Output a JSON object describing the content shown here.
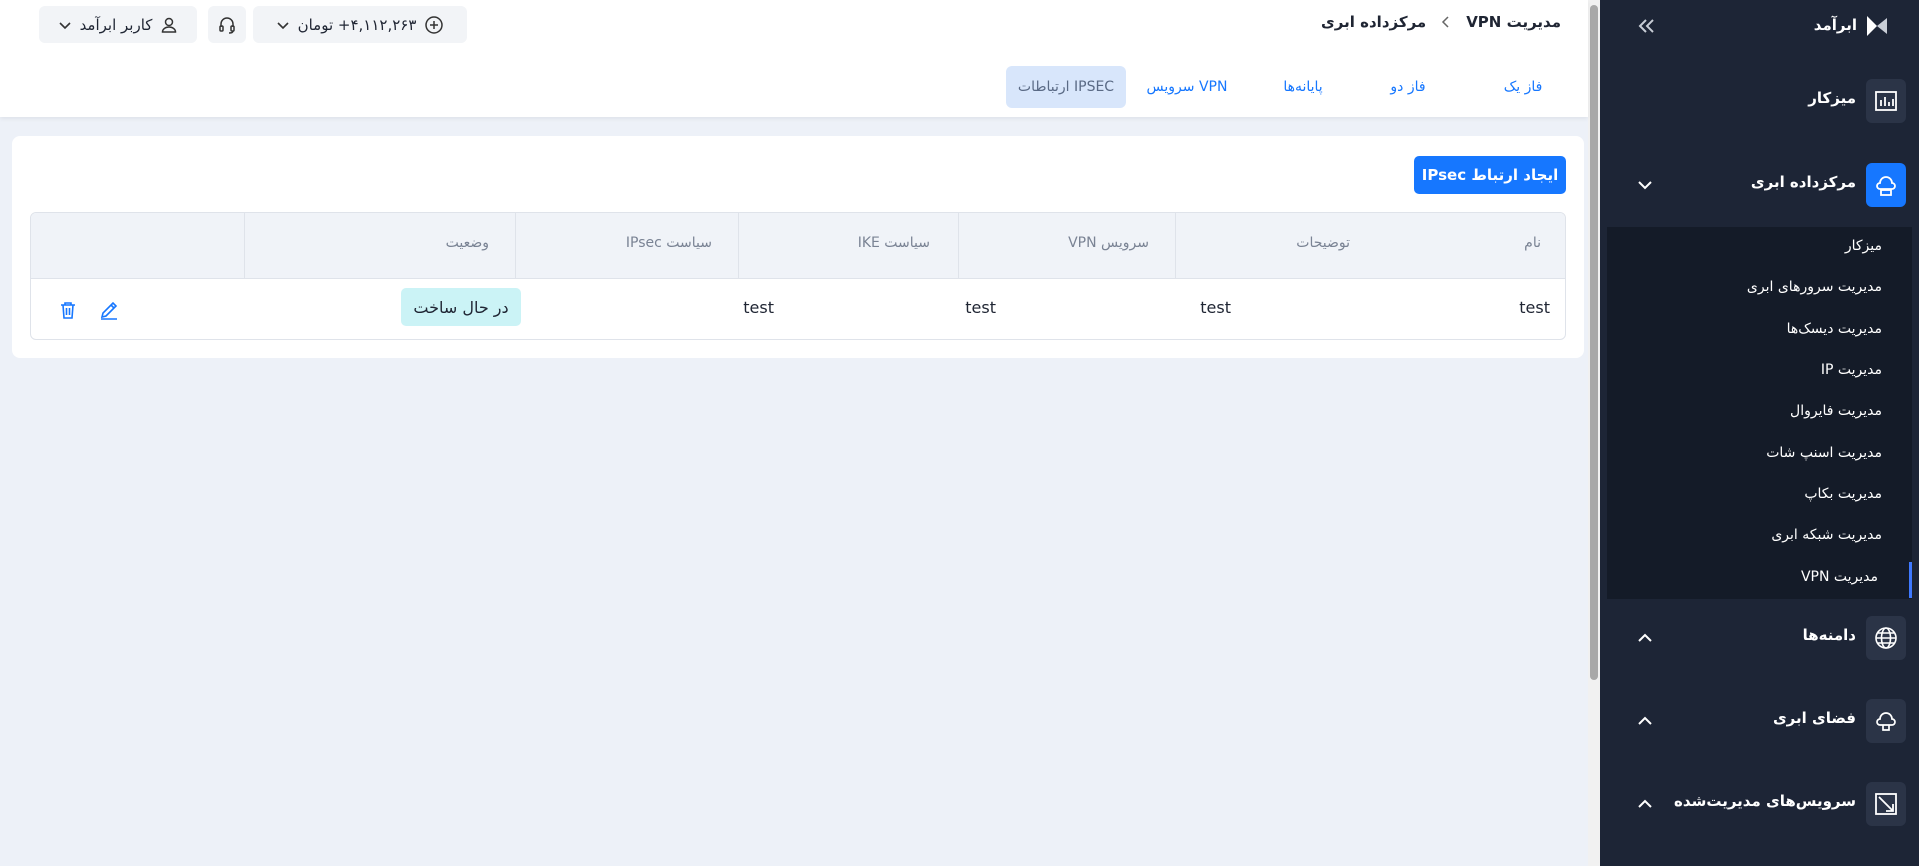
{
  "brand": {
    "name": "ابرآمد"
  },
  "sidebar": {
    "main_items": [
      {
        "label": "میزکار",
        "icon": "dashboard-chart-icon"
      },
      {
        "label": "مرکزداده ابری",
        "icon": "cloud-datacenter-icon"
      },
      {
        "label": "دامنه‌ها",
        "icon": "globe-icon"
      },
      {
        "label": "فضای ابری",
        "icon": "cloud-storage-icon"
      },
      {
        "label": "سرویس‌های مدیریت‌شده",
        "icon": "managed-services-icon"
      }
    ],
    "sub_items": [
      {
        "label": "میزکار"
      },
      {
        "label": "مدیریت سرورهای ابری"
      },
      {
        "label": "مدیریت دیسک‌ها"
      },
      {
        "label": "مدیریت IP"
      },
      {
        "label": "مدیریت فایروال"
      },
      {
        "label": "مدیریت اسنپ شات"
      },
      {
        "label": "مدیریت بکاپ"
      },
      {
        "label": "مدیریت شبکه ابری"
      },
      {
        "label": "مدیریت VPN",
        "active": true
      }
    ]
  },
  "breadcrumb": {
    "parent": "مرکزداده ابری",
    "current": "مدیریت VPN"
  },
  "header": {
    "balance": "۴,۱۱۲,۲۶۳+ تومان",
    "user": "کاربر ابرآمد"
  },
  "tabs": [
    {
      "label": "فاز یک"
    },
    {
      "label": "فاز دو"
    },
    {
      "label": "پایانه‌ها"
    },
    {
      "label": "سرویس VPN"
    },
    {
      "label": "ارتباطات IPSEC",
      "active": true
    }
  ],
  "page": {
    "create_button": "ایجاد ارتباط IPsec"
  },
  "table": {
    "columns": [
      "نام",
      "توضیحات",
      "سرویس VPN",
      "سیاست IKE",
      "سیاست IPsec",
      "وضعیت",
      ""
    ],
    "rows": [
      {
        "name": "test",
        "description": "",
        "vpn_service": "test",
        "ike_policy": "test",
        "ipsec_policy": "test",
        "status": "در حال ساخت"
      }
    ]
  },
  "colors": {
    "accent": "#1677ff",
    "sidebar_bg": "#1d2536",
    "status_building": "#cbf3f6"
  }
}
